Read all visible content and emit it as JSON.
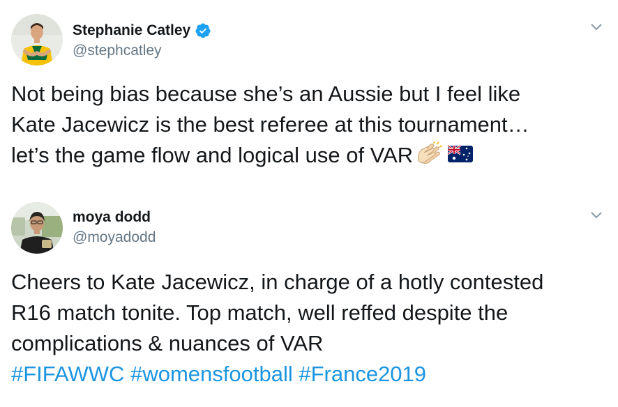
{
  "tweets": [
    {
      "display_name": "Stephanie Catley",
      "verified": true,
      "handle": "@stephcatley",
      "avatar_icon": "avatar-photo-player-icon",
      "text_lines": [
        "Not being bias because she’s an Aussie but I feel like",
        "Kate Jacewicz is the best referee at this tournament…",
        "let’s the game flow and logical use of VAR"
      ],
      "emojis": [
        "clapping-hands-icon",
        "australia-flag-icon"
      ]
    },
    {
      "display_name": "moya dodd",
      "verified": false,
      "handle": "@moyadodd",
      "avatar_icon": "avatar-photo-person-icon",
      "text_lines": [
        "Cheers to Kate Jacewicz, in charge of a hotly contested",
        "R16 match tonite. Top match, well reffed despite the",
        "complications & nuances of VAR"
      ],
      "hashtags": [
        "#FIFAWWC",
        "#womensfootball",
        "#France2019"
      ]
    }
  ],
  "colors": {
    "text": "#14171a",
    "secondary": "#657786",
    "link": "#1b95e0",
    "verified": "#1da1f2"
  }
}
